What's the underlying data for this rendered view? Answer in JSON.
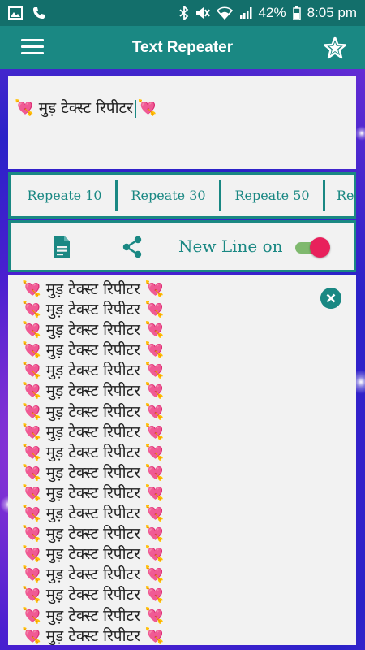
{
  "status_bar": {
    "battery": "42%",
    "time": "8:05 pm"
  },
  "app_bar": {
    "title": "Text Repeater",
    "menu_icon": "hamburger-menu-icon",
    "favorite_icon": "star-icon"
  },
  "input": {
    "text": "💘 मुड़ टेक्स्ट रिपीटर",
    "trailing_emoji": "💘"
  },
  "repeat_buttons": [
    {
      "label": "Repeate 10"
    },
    {
      "label": "Repeate 30"
    },
    {
      "label": "Repeate 50"
    },
    {
      "label": "Re"
    }
  ],
  "actions": {
    "doc_icon": "document-icon",
    "share_icon": "share-icon",
    "new_line_label": "New Line on",
    "new_line_enabled": true
  },
  "output": {
    "line_text": "💘 मुड़ टेक्स्ट रिपीटर 💘",
    "visible_lines": 18,
    "clear_icon": "close-circle-icon"
  },
  "colors": {
    "primary": "#1a8883",
    "status_bar": "#136f6b",
    "toggle_thumb": "#e8215c",
    "toggle_track": "#7fb96e"
  }
}
